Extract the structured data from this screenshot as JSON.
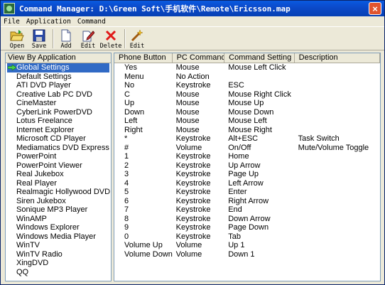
{
  "window": {
    "title": "Command Manager: D:\\Green Soft\\手机软件\\Remote\\Ericsson.map"
  },
  "menu": [
    "File",
    "Application",
    "Command"
  ],
  "toolbar": {
    "open_label": "Open",
    "save_label": "Save",
    "add_label": "Add",
    "edit_label": "Edit",
    "delete_label": "Delete",
    "edit2_label": "Edit"
  },
  "apps": {
    "header": "View By Application",
    "items": [
      "Global Settings",
      "Default Settings",
      "ATI DVD Player",
      "Creative Lab PC DVD",
      "CineMaster",
      "CyberLink PowerDVD",
      "Lotus Freelance",
      "Internet Explorer",
      "Microsoft CD Player",
      "Mediamatics DVD Express",
      "PowerPoint",
      "PowerPoint Viewer",
      "Real Jukebox",
      "Real Player",
      "Realmagic Hollywood DVD",
      "Siren Jukebox",
      "Sonique MP3 Player",
      "WinAMP",
      "Windows Explorer",
      "Windows Media Player",
      "WinTV",
      "WinTV Radio",
      "XingDVD",
      "QQ"
    ],
    "selected_index": 0
  },
  "commands": {
    "columns": [
      "Phone Button",
      "PC Command",
      "Command Setting",
      "Description"
    ],
    "rows": [
      [
        "Yes",
        "Mouse",
        "Mouse Left Click",
        ""
      ],
      [
        "Menu",
        "No Action",
        "",
        ""
      ],
      [
        "No",
        "Keystroke",
        "ESC",
        ""
      ],
      [
        "C",
        "Mouse",
        "Mouse Right Click",
        ""
      ],
      [
        "Up",
        "Mouse",
        "Mouse Up",
        ""
      ],
      [
        "Down",
        "Mouse",
        "Mouse Down",
        ""
      ],
      [
        "Left",
        "Mouse",
        "Mouse Left",
        ""
      ],
      [
        "Right",
        "Mouse",
        "Mouse Right",
        ""
      ],
      [
        "*",
        "Keystroke",
        "Alt+ESC",
        "Task Switch"
      ],
      [
        "#",
        "Volume",
        "On/Off",
        "Mute/Volume Toggle"
      ],
      [
        "1",
        "Keystroke",
        "Home",
        ""
      ],
      [
        "2",
        "Keystroke",
        "Up Arrow",
        ""
      ],
      [
        "3",
        "Keystroke",
        "Page Up",
        ""
      ],
      [
        "4",
        "Keystroke",
        "Left Arrow",
        ""
      ],
      [
        "5",
        "Keystroke",
        "Enter",
        ""
      ],
      [
        "6",
        "Keystroke",
        "Right Arrow",
        ""
      ],
      [
        "7",
        "Keystroke",
        "End",
        ""
      ],
      [
        "8",
        "Keystroke",
        "Down Arrow",
        ""
      ],
      [
        "9",
        "Keystroke",
        "Page Down",
        ""
      ],
      [
        "0",
        "Keystroke",
        "Tab",
        ""
      ],
      [
        "Volume Up",
        "Volume",
        "Up 1",
        ""
      ],
      [
        "Volume Down",
        "Volume",
        "Down 1",
        ""
      ]
    ]
  },
  "colors": {
    "titlebar": "#0b49c8",
    "selection": "#316ac5",
    "window_bg": "#ece9d8",
    "close_button": "#e0552f"
  }
}
